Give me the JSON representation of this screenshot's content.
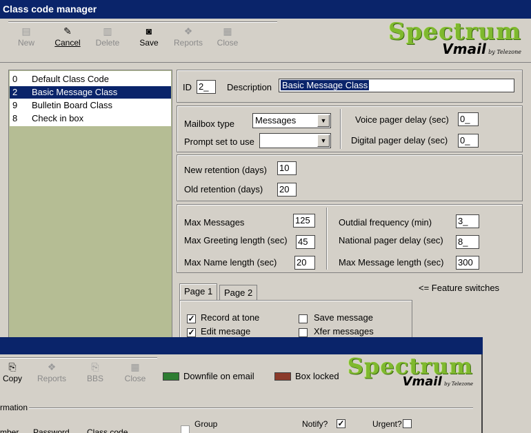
{
  "window": {
    "title": "Class code manager"
  },
  "toolbar": {
    "new": "New",
    "cancel": "Cancel",
    "delete": "Delete",
    "save": "Save",
    "reports": "Reports",
    "close": "Close"
  },
  "logo": {
    "spectrum": "Spectrum",
    "vmail": "Vmail",
    "by": "by Telezone"
  },
  "class_list": [
    {
      "id": "0",
      "name": "Default Class Code"
    },
    {
      "id": "2",
      "name": "Basic Message Class"
    },
    {
      "id": "9",
      "name": "Bulletin Board Class"
    },
    {
      "id": "8",
      "name": "Check in box"
    }
  ],
  "selected_index": 1,
  "header": {
    "id_label": "ID",
    "id_value": "2_",
    "desc_label": "Description",
    "desc_value": "Basic Message Class"
  },
  "mailbox": {
    "type_label": "Mailbox type",
    "type_value": "Messages",
    "prompt_label": "Prompt set to use",
    "prompt_value": "",
    "voice_label": "Voice pager delay (sec)",
    "voice_value": "0_",
    "digital_label": "Digital pager delay (sec)",
    "digital_value": "0_"
  },
  "retention": {
    "new_label": "New retention (days)",
    "new_value": "10",
    "old_label": "Old retention (days)",
    "old_value": "20"
  },
  "limits": {
    "max_messages_label": "Max Messages",
    "max_messages_value": "125",
    "max_greeting_label": "Max Greeting length (sec)",
    "max_greeting_value": "45",
    "max_name_label": "Max Name length (sec)",
    "max_name_value": "20",
    "outdial_label": "Outdial frequency (min)",
    "outdial_value": "3_",
    "national_label": "National pager delay (sec)",
    "national_value": "8_",
    "max_msg_len_label": "Max Message length (sec)",
    "max_msg_len_value": "300"
  },
  "tabs": {
    "page1": "Page 1",
    "page2": "Page 2",
    "hint": "<= Feature switches"
  },
  "features": [
    {
      "label": "Record at tone",
      "checked": true
    },
    {
      "label": "Save message",
      "checked": false
    },
    {
      "label": "Edit mesage",
      "checked": true
    },
    {
      "label": "Xfer messages",
      "checked": false
    }
  ],
  "second_window": {
    "toolbar": {
      "copy": "Copy",
      "reports": "Reports",
      "bbs": "BBS",
      "close": "Close"
    },
    "downfile_label": "Downfile on email",
    "boxlocked_label": "Box locked",
    "section_label": "rmation",
    "col1": "mber",
    "col2": "Password",
    "col3": "Class code",
    "group_label": "Group",
    "notify_label": "Notify?",
    "notify_checked": true,
    "urgent_label": "Urgent?",
    "urgent_checked": false
  },
  "colors": {
    "titlebar": "#0a246a",
    "selection": "#0a246a",
    "list_bg": "#b5bd94",
    "logo_green": "#7fb92e",
    "downfile_swatch": "#2e7d32",
    "boxlocked_swatch": "#8b3a2a"
  }
}
